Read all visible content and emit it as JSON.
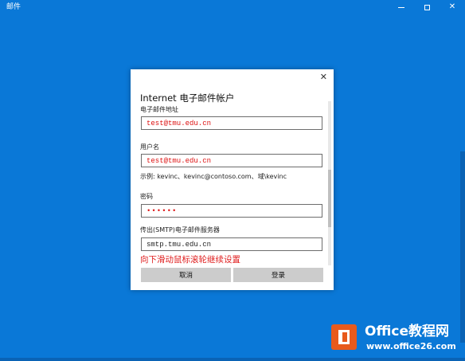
{
  "window": {
    "title": "邮件",
    "controls": {
      "minimize": "—",
      "maximize": "",
      "close": "✕"
    }
  },
  "dialog": {
    "close_icon": "✕",
    "title": "Internet 电子邮件帐户",
    "email_label": "电子邮件地址",
    "email_value": "test@tmu.edu.cn",
    "username_label": "用户名",
    "username_value": "test@tmu.edu.cn",
    "username_hint": "示例: kevinc、kevinc@contoso.com、域\\kevinc",
    "password_label": "密码",
    "password_value": "••••••",
    "smtp_label": "传出(SMTP)电子邮件服务器",
    "smtp_value": "smtp.tmu.edu.cn",
    "scroll_note": "向下滑动鼠标滚轮继续设置",
    "cancel_button": "取消",
    "login_button": "登录"
  },
  "watermark": {
    "title": "Office教程网",
    "url": "www.office26.com"
  },
  "colors": {
    "background": "#0a78d7",
    "field_text": "#dd1111",
    "note_text": "#e02020",
    "logo": "#e85a1c"
  }
}
